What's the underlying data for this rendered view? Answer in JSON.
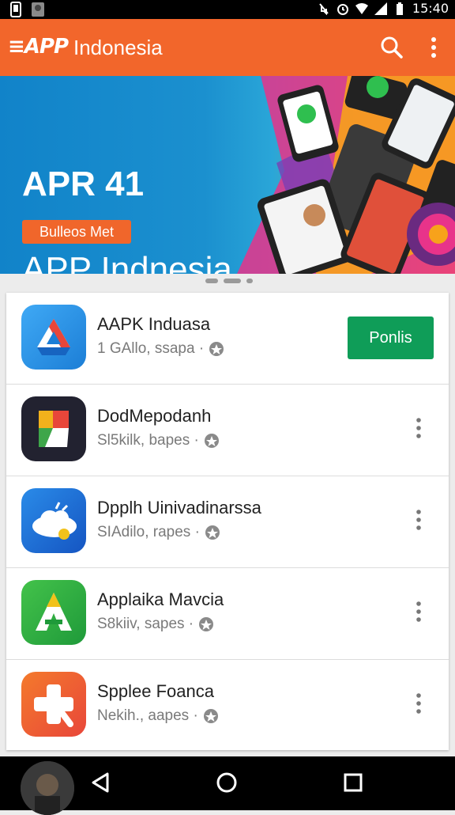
{
  "status_bar": {
    "time": "15:40",
    "icons": [
      "notification-icon",
      "image-icon",
      "mute-icon",
      "alarm-icon",
      "wifi-icon",
      "signal-icon",
      "battery-icon"
    ]
  },
  "app_bar": {
    "logo": "≡APP",
    "title": "Indonesia",
    "actions": [
      "search-icon",
      "more-vert-icon"
    ],
    "color": "#f2662b"
  },
  "banner": {
    "title_line1": "APR 41",
    "title_line2": "APP Indnesia",
    "cta": "Bulleos Met"
  },
  "pager": {
    "dots": 3,
    "active": 1
  },
  "apps": [
    {
      "name": "AAPK Induasa",
      "sub": "1 GAllo, ssapa ·",
      "action": "Ponlis",
      "icon": "drive-icon"
    },
    {
      "name": "DodMepodanh",
      "sub": "Sl5kilk, bapes ·",
      "icon": "flag-app-icon"
    },
    {
      "name": "Dpplh Uinivadinarssa",
      "sub": "SIAdilo, rapes ·",
      "icon": "cloud-app-icon"
    },
    {
      "name": "Applaika Mavcia",
      "sub": "S8kiiv, sapes ·",
      "icon": "a-letter-app-icon"
    },
    {
      "name": "Spplee Foanca",
      "sub": "Nekih., aapes ·",
      "icon": "plus-app-icon"
    }
  ],
  "colors": {
    "accent": "#f2662b",
    "install": "#0f9d58",
    "banner_blue": "#1183c9"
  },
  "nav_bar": {
    "buttons": [
      "back-icon",
      "home-icon",
      "recents-icon"
    ]
  }
}
